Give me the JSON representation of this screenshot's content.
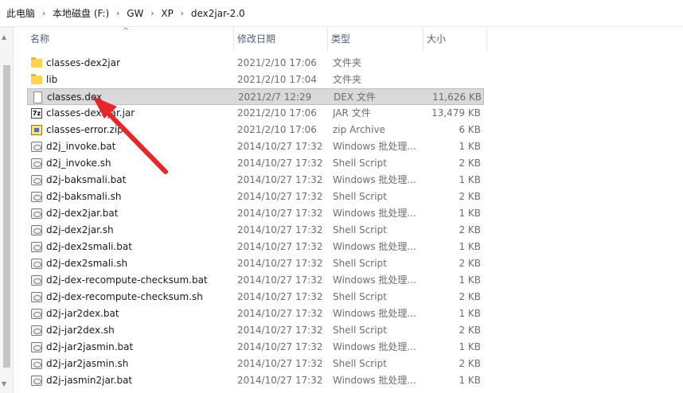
{
  "breadcrumb": {
    "items": [
      "此电脑",
      "本地磁盘 (F:)",
      "GW",
      "XP",
      "dex2jar-2.0"
    ],
    "separator": "›"
  },
  "columns": {
    "name": "名称",
    "date": "修改日期",
    "type": "类型",
    "size": "大小"
  },
  "files": [
    {
      "name": "classes-dex2jar",
      "date": "2021/2/10 17:06",
      "type": "文件夹",
      "size": "",
      "icon": "folder-icon"
    },
    {
      "name": "lib",
      "date": "2021/2/10 17:04",
      "type": "文件夹",
      "size": "",
      "icon": "folder-icon"
    },
    {
      "name": "classes.dex",
      "date": "2021/2/7 12:29",
      "type": "DEX 文件",
      "size": "11,626 KB",
      "icon": "file-icon"
    },
    {
      "name": "classes-dex2jar.jar",
      "date": "2021/2/10 17:06",
      "type": "JAR 文件",
      "size": "13,479 KB",
      "icon": "jar-icon"
    },
    {
      "name": "classes-error.zip",
      "date": "2021/2/10 17:06",
      "type": "zip Archive",
      "size": "6 KB",
      "icon": "zip-icon"
    },
    {
      "name": "d2j_invoke.bat",
      "date": "2014/10/27 17:32",
      "type": "Windows 批处理...",
      "size": "1 KB",
      "icon": "script-icon"
    },
    {
      "name": "d2j_invoke.sh",
      "date": "2014/10/27 17:32",
      "type": "Shell Script",
      "size": "2 KB",
      "icon": "script-icon"
    },
    {
      "name": "d2j-baksmali.bat",
      "date": "2014/10/27 17:32",
      "type": "Windows 批处理...",
      "size": "1 KB",
      "icon": "script-icon"
    },
    {
      "name": "d2j-baksmali.sh",
      "date": "2014/10/27 17:32",
      "type": "Shell Script",
      "size": "2 KB",
      "icon": "script-icon"
    },
    {
      "name": "d2j-dex2jar.bat",
      "date": "2014/10/27 17:32",
      "type": "Windows 批处理...",
      "size": "1 KB",
      "icon": "script-icon"
    },
    {
      "name": "d2j-dex2jar.sh",
      "date": "2014/10/27 17:32",
      "type": "Shell Script",
      "size": "2 KB",
      "icon": "script-icon"
    },
    {
      "name": "d2j-dex2smali.bat",
      "date": "2014/10/27 17:32",
      "type": "Windows 批处理...",
      "size": "1 KB",
      "icon": "script-icon"
    },
    {
      "name": "d2j-dex2smali.sh",
      "date": "2014/10/27 17:32",
      "type": "Shell Script",
      "size": "2 KB",
      "icon": "script-icon"
    },
    {
      "name": "d2j-dex-recompute-checksum.bat",
      "date": "2014/10/27 17:32",
      "type": "Windows 批处理...",
      "size": "1 KB",
      "icon": "script-icon"
    },
    {
      "name": "d2j-dex-recompute-checksum.sh",
      "date": "2014/10/27 17:32",
      "type": "Shell Script",
      "size": "2 KB",
      "icon": "script-icon"
    },
    {
      "name": "d2j-jar2dex.bat",
      "date": "2014/10/27 17:32",
      "type": "Windows 批处理...",
      "size": "1 KB",
      "icon": "script-icon"
    },
    {
      "name": "d2j-jar2dex.sh",
      "date": "2014/10/27 17:32",
      "type": "Shell Script",
      "size": "2 KB",
      "icon": "script-icon"
    },
    {
      "name": "d2j-jar2jasmin.bat",
      "date": "2014/10/27 17:32",
      "type": "Windows 批处理...",
      "size": "1 KB",
      "icon": "script-icon"
    },
    {
      "name": "d2j-jar2jasmin.sh",
      "date": "2014/10/27 17:32",
      "type": "Shell Script",
      "size": "2 KB",
      "icon": "script-icon"
    },
    {
      "name": "d2j-jasmin2jar.bat",
      "date": "2014/10/27 17:32",
      "type": "Windows 批处理...",
      "size": "1 KB",
      "icon": "script-icon"
    }
  ],
  "selected_file": "classes.dex",
  "colors": {
    "selection": "#d9d9d9",
    "annotation_arrow": "#e8262a",
    "folder": "#ffd34e"
  }
}
